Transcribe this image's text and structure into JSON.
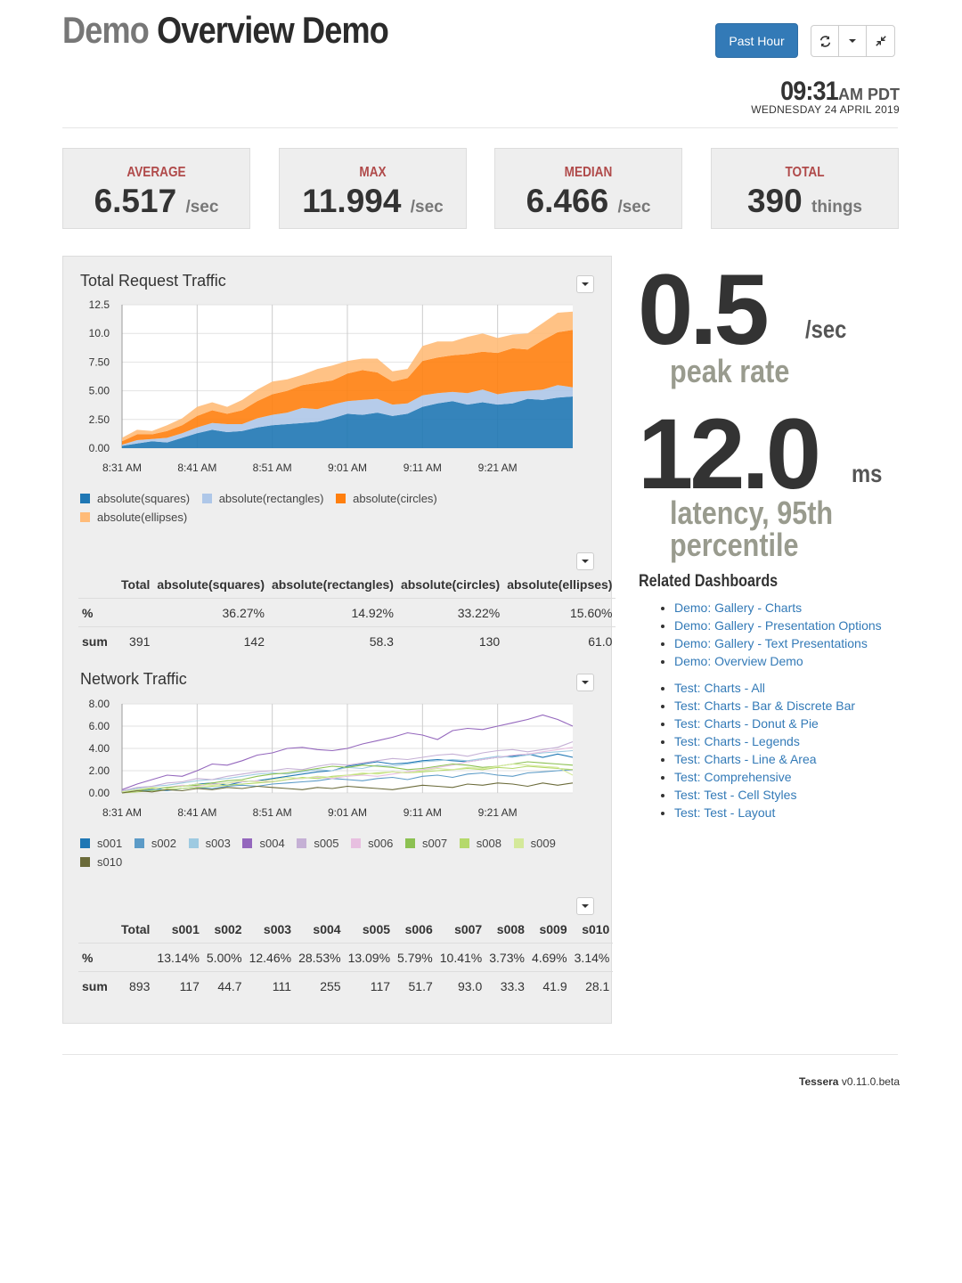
{
  "header": {
    "title_prefix": "Demo",
    "title_main": "Overview Demo",
    "time_range_label": "Past Hour",
    "refresh_icon": "refresh-icon",
    "caret_icon": "chevron-down-icon",
    "compress_icon": "compress-icon",
    "clock_time": "09:31",
    "clock_ampm": "AM PDT",
    "clock_date": "WEDNESDAY 24 APRIL 2019"
  },
  "stats": [
    {
      "label": "AVERAGE",
      "value": "6.517",
      "unit": "/sec"
    },
    {
      "label": "MAX",
      "value": "11.994",
      "unit": "/sec"
    },
    {
      "label": "MEDIAN",
      "value": "6.466",
      "unit": "/sec"
    },
    {
      "label": "TOTAL",
      "value": "390",
      "unit": "things"
    }
  ],
  "traffic": {
    "title": "Total Request Traffic",
    "legend": [
      "absolute(squares)",
      "absolute(rectangles)",
      "absolute(circles)",
      "absolute(ellipses)"
    ],
    "table": {
      "headers": [
        "Total",
        "absolute(squares)",
        "absolute(rectangles)",
        "absolute(circles)",
        "absolute(ellipses)"
      ],
      "rows": [
        {
          "label": "%",
          "cells": [
            "",
            "36.27%",
            "14.92%",
            "33.22%",
            "15.60%"
          ]
        },
        {
          "label": "sum",
          "cells": [
            "391",
            "142",
            "58.3",
            "130",
            "61.0"
          ]
        }
      ]
    }
  },
  "network": {
    "title": "Network Traffic",
    "legend": [
      "s001",
      "s002",
      "s003",
      "s004",
      "s005",
      "s006",
      "s007",
      "s008",
      "s009",
      "s010"
    ],
    "table": {
      "headers": [
        "Total",
        "s001",
        "s002",
        "s003",
        "s004",
        "s005",
        "s006",
        "s007",
        "s008",
        "s009",
        "s010"
      ],
      "rows": [
        {
          "label": "%",
          "cells": [
            "",
            "13.14%",
            "5.00%",
            "12.46%",
            "28.53%",
            "13.09%",
            "5.79%",
            "10.41%",
            "3.73%",
            "4.69%",
            "3.14%"
          ]
        },
        {
          "label": "sum",
          "cells": [
            "893",
            "117",
            "44.7",
            "111",
            "255",
            "117",
            "51.7",
            "93.0",
            "33.3",
            "41.9",
            "28.1"
          ]
        }
      ]
    }
  },
  "singlestats": {
    "peak_value": "0.5",
    "peak_unit": "/sec",
    "peak_caption": "peak rate",
    "latency_value": "12.0",
    "latency_unit": "ms",
    "latency_caption_1": "latency, 95th",
    "latency_caption_2": "percentile"
  },
  "related": {
    "heading": "Related Dashboards",
    "demo_links": [
      "Demo: Gallery - Charts",
      "Demo: Gallery - Presentation Options",
      "Demo: Gallery - Text Presentations",
      "Demo: Overview Demo"
    ],
    "test_links": [
      "Test: Charts - All",
      "Test: Charts - Bar & Discrete Bar",
      "Test: Charts - Donut & Pie",
      "Test: Charts - Legends",
      "Test: Charts - Line & Area",
      "Test: Comprehensive",
      "Test: Test - Cell Styles",
      "Test: Test - Layout"
    ]
  },
  "footer": {
    "brand": "Tessera",
    "version": "v0.11.0.beta"
  },
  "chart_data": [
    {
      "type": "area",
      "title": "Total Request Traffic",
      "x": [
        "8:31 AM",
        "8:33 AM",
        "8:35 AM",
        "8:37 AM",
        "8:39 AM",
        "8:41 AM",
        "8:43 AM",
        "8:45 AM",
        "8:47 AM",
        "8:49 AM",
        "8:51 AM",
        "8:53 AM",
        "8:55 AM",
        "8:57 AM",
        "8:59 AM",
        "9:01 AM",
        "9:03 AM",
        "9:05 AM",
        "9:07 AM",
        "9:09 AM",
        "9:11 AM",
        "9:13 AM",
        "9:15 AM",
        "9:17 AM",
        "9:19 AM",
        "9:21 AM",
        "9:23 AM",
        "9:25 AM",
        "9:27 AM",
        "9:29 AM",
        "9:31 AM"
      ],
      "x_ticks": [
        "8:31 AM",
        "8:41 AM",
        "8:51 AM",
        "9:01 AM",
        "9:11 AM",
        "9:21 AM"
      ],
      "y_ticks": [
        "0.00",
        "2.50",
        "5.00",
        "7.50",
        "10.0",
        "12.5"
      ],
      "ylim": [
        0,
        12.5
      ],
      "stacked": true,
      "colors": [
        "#1f77b4",
        "#aec7e8",
        "#ff7f0e",
        "#ffbb78"
      ],
      "series": [
        {
          "name": "absolute(squares)",
          "values": [
            0.2,
            0.4,
            0.6,
            0.5,
            0.9,
            1.3,
            1.6,
            1.4,
            1.5,
            1.8,
            2.0,
            2.1,
            2.2,
            2.3,
            2.6,
            3.0,
            2.9,
            3.1,
            2.8,
            3.0,
            3.6,
            3.9,
            4.1,
            3.8,
            4.0,
            3.8,
            3.9,
            4.3,
            4.2,
            4.4,
            4.5
          ]
        },
        {
          "name": "absolute(rectangles)",
          "values": [
            0.1,
            0.3,
            0.2,
            0.4,
            0.4,
            0.5,
            0.6,
            0.7,
            0.6,
            0.8,
            0.9,
            1.0,
            1.3,
            1.1,
            1.2,
            1.1,
            1.3,
            1.2,
            1.0,
            0.9,
            1.0,
            0.9,
            0.8,
            1.0,
            1.1,
            0.9,
            1.0,
            0.7,
            0.9,
            1.1,
            0.8
          ]
        },
        {
          "name": "absolute(circles)",
          "values": [
            0.3,
            0.5,
            0.4,
            0.6,
            0.7,
            1.0,
            1.1,
            0.9,
            1.2,
            1.5,
            1.8,
            1.9,
            2.0,
            2.3,
            2.1,
            2.4,
            2.6,
            2.3,
            2.0,
            2.2,
            3.0,
            3.1,
            3.2,
            3.4,
            3.3,
            3.6,
            3.8,
            3.6,
            4.3,
            4.6,
            5.0
          ]
        },
        {
          "name": "absolute(ellipses)",
          "values": [
            0.3,
            0.4,
            0.3,
            0.5,
            0.6,
            0.8,
            0.7,
            0.6,
            0.9,
            1.0,
            1.1,
            1.0,
            0.9,
            1.2,
            1.3,
            1.1,
            1.0,
            1.2,
            0.9,
            0.8,
            1.3,
            1.4,
            1.2,
            1.5,
            1.6,
            1.3,
            1.2,
            1.4,
            1.5,
            1.7,
            1.6
          ]
        }
      ]
    },
    {
      "type": "line",
      "title": "Network Traffic",
      "x": [
        "8:31 AM",
        "8:33 AM",
        "8:35 AM",
        "8:37 AM",
        "8:39 AM",
        "8:41 AM",
        "8:43 AM",
        "8:45 AM",
        "8:47 AM",
        "8:49 AM",
        "8:51 AM",
        "8:53 AM",
        "8:55 AM",
        "8:57 AM",
        "8:59 AM",
        "9:01 AM",
        "9:03 AM",
        "9:05 AM",
        "9:07 AM",
        "9:09 AM",
        "9:11 AM",
        "9:13 AM",
        "9:15 AM",
        "9:17 AM",
        "9:19 AM",
        "9:21 AM",
        "9:23 AM",
        "9:25 AM",
        "9:27 AM",
        "9:29 AM",
        "9:31 AM"
      ],
      "x_ticks": [
        "8:31 AM",
        "8:41 AM",
        "8:51 AM",
        "9:01 AM",
        "9:11 AM",
        "9:21 AM"
      ],
      "y_ticks": [
        "0.00",
        "2.00",
        "4.00",
        "6.00",
        "8.00"
      ],
      "ylim": [
        0,
        8
      ],
      "colors": [
        "#1f77b4",
        "#5c9bc7",
        "#9ecae1",
        "#9467bd",
        "#c5b0d5",
        "#e7bfe0",
        "#8cc152",
        "#b5d96b",
        "#d4e99a",
        "#6b6b3a"
      ],
      "series": [
        {
          "name": "s001",
          "values": [
            0.1,
            0.3,
            0.2,
            0.5,
            0.6,
            0.8,
            0.9,
            0.7,
            1.0,
            1.1,
            1.3,
            1.5,
            1.7,
            1.9,
            2.0,
            2.4,
            2.6,
            2.8,
            2.6,
            2.7,
            2.9,
            3.0,
            2.9,
            2.8,
            3.0,
            3.2,
            3.3,
            3.5,
            3.2,
            3.5,
            3.2
          ]
        },
        {
          "name": "s002",
          "values": [
            0.0,
            0.2,
            0.3,
            0.2,
            0.4,
            0.5,
            0.4,
            0.6,
            0.7,
            0.6,
            0.8,
            0.9,
            1.0,
            1.1,
            1.3,
            1.2,
            1.1,
            1.3,
            1.4,
            1.2,
            1.5,
            1.6,
            1.4,
            1.7,
            1.8,
            1.6,
            1.5,
            1.8,
            1.9,
            2.0,
            2.1
          ]
        },
        {
          "name": "s003",
          "values": [
            0.2,
            0.4,
            0.6,
            0.7,
            0.9,
            1.1,
            1.2,
            1.3,
            1.5,
            1.7,
            1.8,
            1.7,
            1.9,
            2.1,
            2.0,
            2.3,
            2.2,
            2.5,
            2.4,
            2.6,
            2.8,
            2.9,
            3.0,
            2.9,
            3.1,
            3.3,
            3.2,
            3.4,
            3.6,
            3.7,
            3.8
          ]
        },
        {
          "name": "s004",
          "values": [
            0.3,
            0.8,
            1.2,
            1.6,
            1.5,
            2.0,
            2.6,
            2.5,
            2.9,
            3.4,
            3.6,
            4.0,
            4.1,
            3.9,
            3.8,
            4.0,
            4.4,
            4.7,
            5.0,
            5.4,
            5.2,
            4.8,
            5.6,
            5.8,
            5.7,
            6.0,
            6.3,
            6.6,
            7.0,
            6.6,
            6.0
          ]
        },
        {
          "name": "s005",
          "values": [
            0.2,
            0.5,
            0.6,
            0.9,
            1.0,
            1.3,
            1.2,
            1.5,
            1.7,
            1.9,
            2.0,
            2.2,
            2.1,
            2.4,
            2.6,
            2.5,
            2.7,
            2.9,
            3.1,
            3.0,
            3.2,
            3.4,
            3.5,
            3.3,
            3.6,
            3.8,
            3.9,
            3.7,
            3.9,
            4.1,
            4.6
          ]
        },
        {
          "name": "s006",
          "values": [
            0.1,
            0.3,
            0.4,
            0.5,
            0.7,
            0.6,
            0.8,
            0.9,
            1.0,
            1.1,
            1.0,
            1.2,
            1.3,
            1.4,
            1.3,
            1.5,
            1.6,
            1.5,
            1.7,
            1.9,
            2.1,
            2.3,
            2.5,
            2.8,
            3.0,
            3.2,
            3.4,
            3.5,
            3.7,
            3.9,
            4.1
          ]
        },
        {
          "name": "s007",
          "values": [
            0.1,
            0.2,
            0.4,
            0.5,
            0.6,
            0.7,
            0.9,
            1.1,
            1.2,
            1.5,
            1.7,
            1.8,
            2.0,
            2.2,
            2.4,
            2.3,
            2.5,
            2.4,
            2.3,
            2.1,
            2.2,
            2.4,
            2.6,
            2.5,
            2.3,
            2.4,
            2.6,
            2.8,
            2.7,
            2.6,
            2.5
          ]
        },
        {
          "name": "s008",
          "values": [
            0.0,
            0.1,
            0.2,
            0.3,
            0.4,
            0.5,
            0.6,
            0.7,
            0.8,
            0.9,
            1.0,
            1.2,
            1.4,
            1.3,
            1.5,
            1.6,
            1.7,
            1.8,
            1.9,
            1.8,
            1.9,
            2.0,
            2.1,
            2.2,
            2.1,
            2.3,
            2.2,
            2.4,
            2.3,
            2.2,
            2.1
          ]
        },
        {
          "name": "s009",
          "values": [
            0.1,
            0.3,
            0.5,
            0.4,
            0.6,
            0.8,
            0.7,
            0.9,
            1.1,
            1.0,
            1.2,
            1.4,
            1.3,
            1.5,
            1.4,
            1.6,
            1.8,
            1.7,
            1.9,
            1.8,
            2.0,
            2.2,
            2.1,
            2.3,
            2.2,
            2.4,
            2.6,
            2.5,
            2.4,
            2.3,
            1.6
          ]
        },
        {
          "name": "s010",
          "values": [
            0.0,
            0.2,
            0.1,
            0.3,
            0.2,
            0.4,
            0.3,
            0.5,
            0.4,
            0.6,
            0.5,
            0.4,
            0.3,
            0.5,
            0.4,
            0.6,
            0.5,
            0.4,
            0.3,
            0.5,
            0.7,
            0.6,
            0.5,
            0.8,
            0.7,
            0.9,
            0.8,
            0.6,
            0.9,
            0.7,
            0.9
          ]
        }
      ]
    }
  ]
}
